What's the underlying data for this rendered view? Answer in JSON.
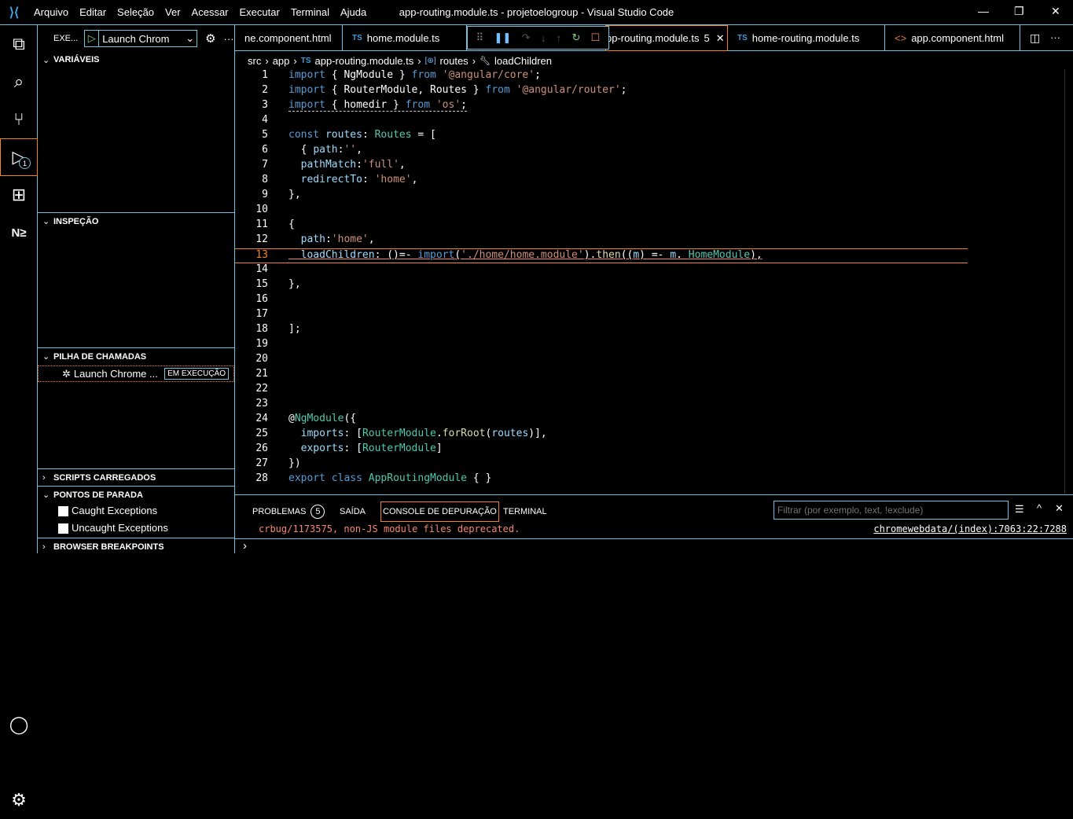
{
  "title": {
    "menu": [
      "Arquivo",
      "Editar",
      "Seleção",
      "Ver",
      "Acessar",
      "Executar",
      "Terminal",
      "Ajuda"
    ],
    "window_title": "app-routing.module.ts - projetoelogroup - Visual Studio Code"
  },
  "activity": {
    "debug_badge": "1",
    "extension_label": "N≥"
  },
  "sidebar": {
    "header": "EXE...",
    "launch_config": "Launch Chrom",
    "sections": {
      "variables": "VARIÁVEIS",
      "watch": "INSPEÇÃO",
      "callstack": "PILHA DE CHAMADAS",
      "scripts": "SCRIPTS CARREGADOS",
      "breakpoints": "PONTOS DE PARADA",
      "browser_breakpoints": "BROWSER BREAKPOINTS"
    },
    "callstack_item": {
      "label": "Launch Chrome ...",
      "status": "EM EXECUÇÃO"
    },
    "breakpoint_items": [
      {
        "label": "Caught Exceptions",
        "checked": false
      },
      {
        "label": "Uncaught Exceptions",
        "checked": false
      }
    ]
  },
  "tabs": [
    {
      "label": "ne.component.html",
      "type": "html"
    },
    {
      "label": "home.module.ts",
      "type": "ts"
    },
    {
      "label": "pp-routing.module.ts",
      "badge": "5",
      "type": "ts",
      "active": true
    },
    {
      "label": "home-routing.module.ts",
      "type": "ts"
    },
    {
      "label": "app.component.html",
      "type": "html"
    }
  ],
  "breadcrumb": [
    "src",
    "app",
    "app-routing.module.ts",
    "routes",
    "loadChildren"
  ],
  "editor": {
    "current_line": 13,
    "lines": [
      [
        [
          "import",
          "kw"
        ],
        [
          " { NgModule } ",
          ""
        ],
        [
          "from",
          "kw"
        ],
        [
          " ",
          ""
        ],
        [
          "'@angular/core'",
          "str"
        ],
        [
          ";",
          ""
        ]
      ],
      [
        [
          "import",
          "kw"
        ],
        [
          " { RouterModule, Routes } ",
          ""
        ],
        [
          "from",
          "kw"
        ],
        [
          " ",
          ""
        ],
        [
          "'@angular/router'",
          "str"
        ],
        [
          ";",
          ""
        ]
      ],
      [
        [
          "import",
          "kw"
        ],
        [
          " { homedir } ",
          ""
        ],
        [
          "from",
          "kw"
        ],
        [
          " ",
          ""
        ],
        [
          "'os'",
          "str"
        ],
        [
          ";",
          ""
        ]
      ],
      [],
      [
        [
          "const",
          "kw"
        ],
        [
          " ",
          ""
        ],
        [
          "routes",
          "id"
        ],
        [
          ": ",
          ""
        ],
        [
          "Routes",
          "ty"
        ],
        [
          " = [",
          ""
        ]
      ],
      [
        [
          "  { ",
          ""
        ],
        [
          "path",
          "id"
        ],
        [
          ":",
          ""
        ],
        [
          "''",
          "str"
        ],
        [
          ",",
          ""
        ]
      ],
      [
        [
          "  ",
          ""
        ],
        [
          "pathMatch",
          "id"
        ],
        [
          ":",
          ""
        ],
        [
          "'full'",
          "str"
        ],
        [
          ",",
          ""
        ]
      ],
      [
        [
          "  ",
          ""
        ],
        [
          "redirectTo",
          "id"
        ],
        [
          ": ",
          ""
        ],
        [
          "'home'",
          "str"
        ],
        [
          ",",
          ""
        ]
      ],
      [
        [
          "},",
          ""
        ]
      ],
      [],
      [
        [
          "{",
          ""
        ]
      ],
      [
        [
          "  ",
          ""
        ],
        [
          "path",
          "id"
        ],
        [
          ":",
          ""
        ],
        [
          "'home'",
          "str"
        ],
        [
          ",",
          ""
        ]
      ],
      [
        [
          "  ",
          ""
        ],
        [
          "loadChildren",
          "id"
        ],
        [
          ": ()=- ",
          ""
        ],
        [
          "import",
          "kw"
        ],
        [
          "(",
          ""
        ],
        [
          "'./home/home.module'",
          "str"
        ],
        [
          ").",
          ""
        ],
        [
          "then",
          "fn"
        ],
        [
          "((",
          ""
        ],
        [
          "m",
          "id"
        ],
        [
          ") =- ",
          ""
        ],
        [
          "m",
          "id"
        ],
        [
          ". ",
          ""
        ],
        [
          "HomeModule",
          "ty"
        ],
        [
          "),",
          ""
        ]
      ],
      [],
      [
        [
          "},",
          ""
        ]
      ],
      [],
      [],
      [
        [
          "];",
          ""
        ]
      ],
      [],
      [],
      [],
      [],
      [],
      [
        [
          "@",
          ""
        ],
        [
          "NgModule",
          "ty"
        ],
        [
          "({",
          ""
        ]
      ],
      [
        [
          "  ",
          ""
        ],
        [
          "imports",
          "id"
        ],
        [
          ": [",
          ""
        ],
        [
          "RouterModule",
          "ty"
        ],
        [
          ".",
          ""
        ],
        [
          "forRoot",
          "fn"
        ],
        [
          "(",
          ""
        ],
        [
          "routes",
          "id"
        ],
        [
          ")],",
          ""
        ]
      ],
      [
        [
          "  ",
          ""
        ],
        [
          "exports",
          "id"
        ],
        [
          ": [",
          ""
        ],
        [
          "RouterModule",
          "ty"
        ],
        [
          "]",
          ""
        ]
      ],
      [
        [
          "})",
          ""
        ]
      ],
      [
        [
          "export",
          "kw"
        ],
        [
          " ",
          ""
        ],
        [
          "class",
          "kw"
        ],
        [
          " ",
          ""
        ],
        [
          "AppRoutingModule",
          "ty"
        ],
        [
          " { }",
          ""
        ]
      ]
    ]
  },
  "panel": {
    "tabs": [
      "PROBLEMAS",
      "SAÍDA",
      "CONSOLE DE DEPURAÇÃO",
      "TERMINAL"
    ],
    "problems_count": "5",
    "filter_placeholder": "Filtrar (por exemplo, text, !exclude)",
    "message": "crbug/1173575, non-JS module files deprecated.",
    "source_link": "chromewebdata/(index):7063:22:7288",
    "prompt": "›"
  },
  "colors": {
    "border": "#6fc3df",
    "active": "#f38518",
    "error": "#f48771"
  }
}
